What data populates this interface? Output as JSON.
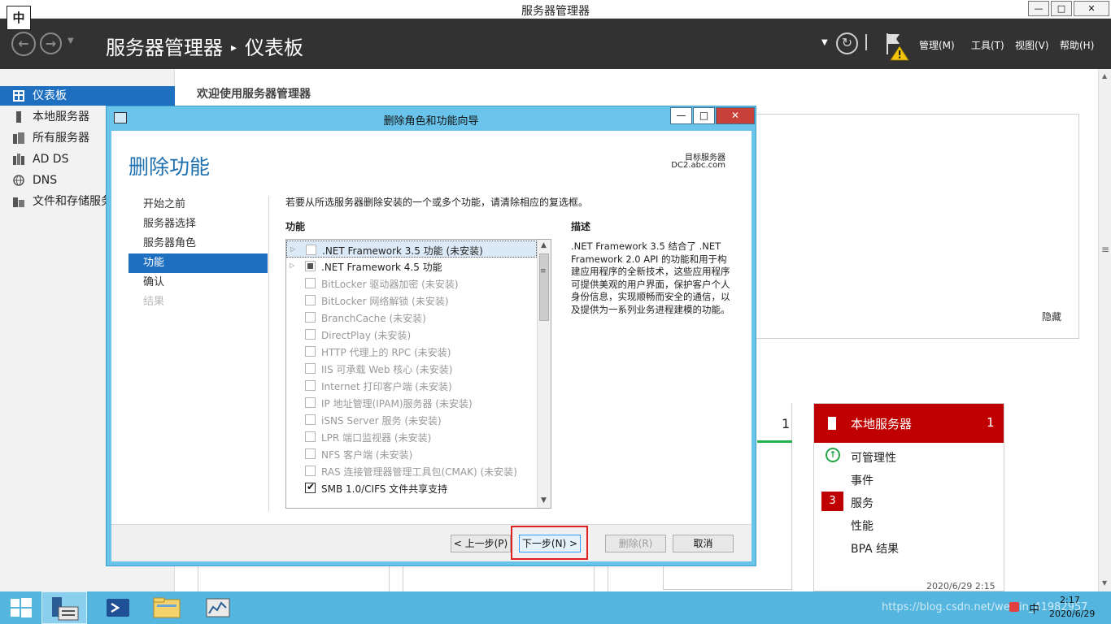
{
  "window": {
    "title": "服务器管理器",
    "ime": "中",
    "min": "—",
    "max": "□",
    "close": "✕"
  },
  "header": {
    "app": "服务器管理器",
    "page": "仪表板",
    "sep": "▸",
    "menus": [
      "管理(M)",
      "工具(T)",
      "视图(V)",
      "帮助(H)"
    ]
  },
  "sidebar": {
    "items": [
      {
        "label": "仪表板",
        "icon": "dashboard-icon"
      },
      {
        "label": "本地服务器",
        "icon": "server-icon"
      },
      {
        "label": "所有服务器",
        "icon": "servers-icon"
      },
      {
        "label": "AD DS",
        "icon": "ad-icon"
      },
      {
        "label": "DNS",
        "icon": "dns-icon"
      },
      {
        "label": "文件和存储服务",
        "icon": "storage-icon"
      }
    ]
  },
  "main": {
    "welcome": "欢迎使用服务器管理器",
    "hide": "隐藏",
    "tile_left_count": "1",
    "tile_local": {
      "title": "本地服务器",
      "count": "1",
      "rows": [
        "可管理性",
        "事件",
        "服务",
        "性能",
        "BPA 结果"
      ],
      "service_badge": "3",
      "date": "2020/6/29 2:15"
    }
  },
  "dialog": {
    "title": "删除角色和功能向导",
    "heading": "删除功能",
    "target_label": "目标服务器",
    "target_value": "DC2.abc.com",
    "steps": [
      {
        "label": "开始之前",
        "state": "normal"
      },
      {
        "label": "服务器选择",
        "state": "normal"
      },
      {
        "label": "服务器角色",
        "state": "normal"
      },
      {
        "label": "功能",
        "state": "active"
      },
      {
        "label": "确认",
        "state": "normal"
      },
      {
        "label": "结果",
        "state": "disabled"
      }
    ],
    "instruction": "若要从所选服务器删除安装的一个或多个功能，请清除相应的复选框。",
    "features_header": "功能",
    "description_header": "描述",
    "description": ".NET Framework 3.5 结合了 .NET Framework 2.0 API 的功能和用于构建应用程序的全新技术，这些应用程序可提供美观的用户界面，保护客户个人身份信息，实现顺畅而安全的通信，以及提供为一系列业务进程建模的功能。",
    "features": [
      {
        "label": ".NET Framework 3.5 功能 (未安装)",
        "expand": true,
        "check": "none",
        "enabled": false,
        "selected": true
      },
      {
        "label": ".NET Framework 4.5 功能",
        "expand": true,
        "check": "partial",
        "enabled": true,
        "selected": false
      },
      {
        "label": "BitLocker 驱动器加密 (未安装)",
        "expand": false,
        "check": "none",
        "enabled": false,
        "selected": false
      },
      {
        "label": "BitLocker 网络解锁 (未安装)",
        "expand": false,
        "check": "none",
        "enabled": false,
        "selected": false
      },
      {
        "label": "BranchCache (未安装)",
        "expand": false,
        "check": "none",
        "enabled": false,
        "selected": false
      },
      {
        "label": "DirectPlay (未安装)",
        "expand": false,
        "check": "none",
        "enabled": false,
        "selected": false
      },
      {
        "label": "HTTP 代理上的 RPC (未安装)",
        "expand": false,
        "check": "none",
        "enabled": false,
        "selected": false
      },
      {
        "label": "IIS 可承载 Web 核心 (未安装)",
        "expand": false,
        "check": "none",
        "enabled": false,
        "selected": false
      },
      {
        "label": "Internet 打印客户端 (未安装)",
        "expand": false,
        "check": "none",
        "enabled": false,
        "selected": false
      },
      {
        "label": "IP 地址管理(IPAM)服务器 (未安装)",
        "expand": false,
        "check": "none",
        "enabled": false,
        "selected": false
      },
      {
        "label": "iSNS Server 服务 (未安装)",
        "expand": false,
        "check": "none",
        "enabled": false,
        "selected": false
      },
      {
        "label": "LPR 端口监视器 (未安装)",
        "expand": false,
        "check": "none",
        "enabled": false,
        "selected": false
      },
      {
        "label": "NFS 客户端 (未安装)",
        "expand": false,
        "check": "none",
        "enabled": false,
        "selected": false
      },
      {
        "label": "RAS 连接管理器管理工具包(CMAK) (未安装)",
        "expand": false,
        "check": "none",
        "enabled": false,
        "selected": false
      },
      {
        "label": "SMB 1.0/CIFS 文件共享支持",
        "expand": false,
        "check": "checked",
        "enabled": true,
        "selected": false
      }
    ],
    "buttons": {
      "prev": "< 上一步(P)",
      "next": "下一步(N) >",
      "remove": "删除(R)",
      "cancel": "取消"
    }
  },
  "taskbar": {
    "watermark": "https://blog.csdn.net/weixin_41982957",
    "time": "2:17",
    "date": "2020/6/29",
    "ime": "中"
  }
}
